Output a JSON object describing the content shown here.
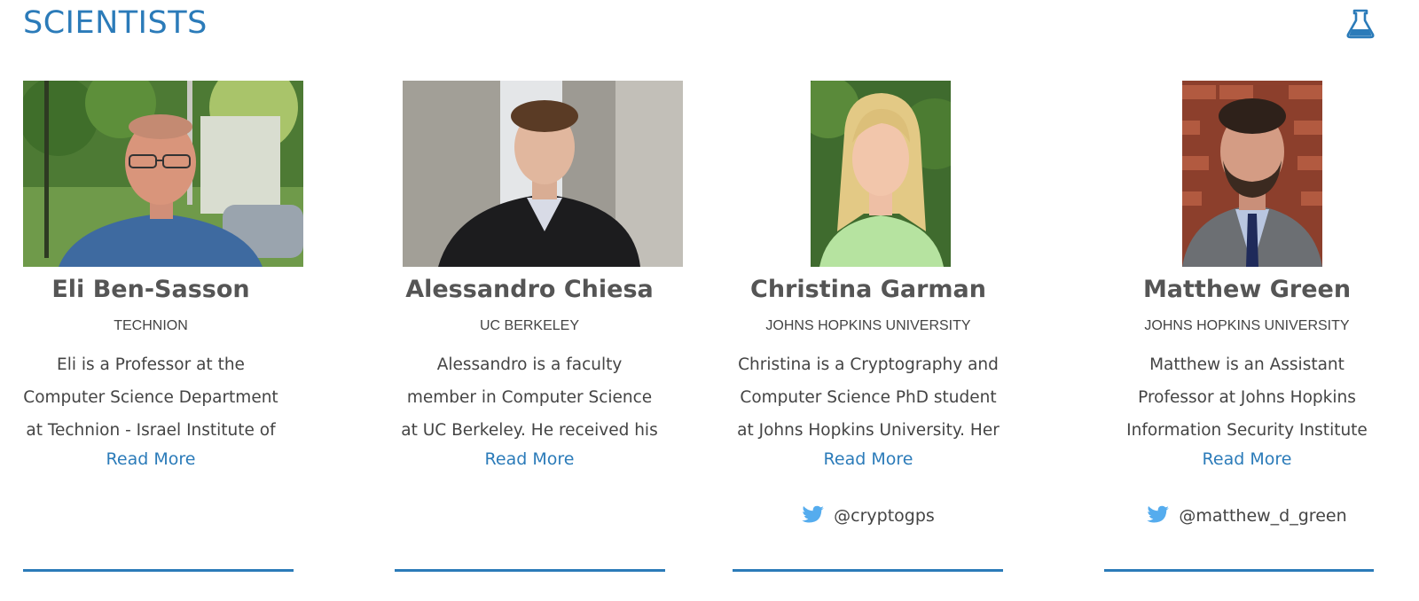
{
  "section": {
    "title": "SCIENTISTS",
    "icon": "flask-icon",
    "accent_color": "#2b7bb9"
  },
  "scientists": [
    {
      "name": "Eli Ben-Sasson",
      "affiliation": "TECHNION",
      "bio": "Eli is a Professor at the Computer Science Department at Technion - Israel Institute of",
      "read_more": "Read More",
      "twitter": ""
    },
    {
      "name": "Alessandro Chiesa",
      "affiliation": "UC BERKELEY",
      "bio": "Alessandro is a faculty member in Computer Science at UC Berkeley. He received his",
      "read_more": "Read More",
      "twitter": ""
    },
    {
      "name": "Christina Garman",
      "affiliation": "JOHNS HOPKINS UNIVERSITY",
      "bio": "Christina is a Cryptography and Computer Science PhD student at Johns Hopkins University. Her",
      "read_more": "Read More",
      "twitter": "@cryptogps"
    },
    {
      "name": "Matthew Green",
      "affiliation": "JOHNS HOPKINS UNIVERSITY",
      "bio": "Matthew is an Assistant Professor at Johns Hopkins Information Security Institute",
      "read_more": "Read More",
      "twitter": "@matthew_d_green"
    }
  ]
}
